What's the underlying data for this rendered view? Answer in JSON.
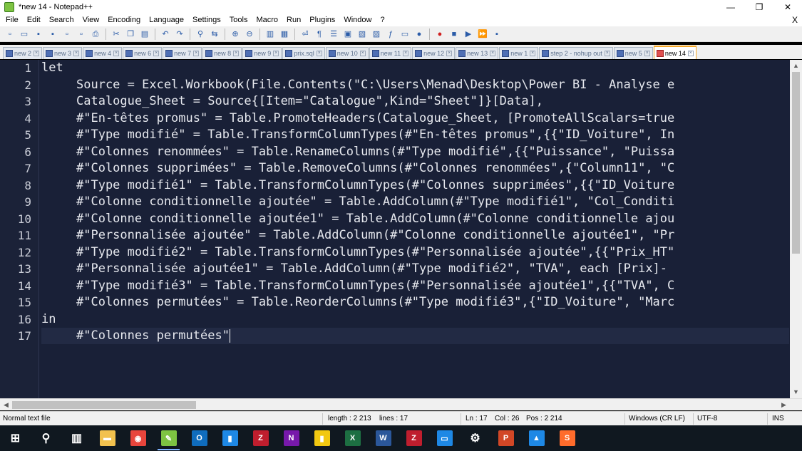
{
  "window": {
    "title": "*new 14 - Notepad++",
    "controls": {
      "minimize": "—",
      "maximize": "❐",
      "close": "✕"
    }
  },
  "menu": {
    "items": [
      "File",
      "Edit",
      "Search",
      "View",
      "Encoding",
      "Language",
      "Settings",
      "Tools",
      "Macro",
      "Run",
      "Plugins",
      "Window",
      "?"
    ],
    "close_doc": "X"
  },
  "tabs": [
    {
      "label": "new 2"
    },
    {
      "label": "new 3"
    },
    {
      "label": "new 4"
    },
    {
      "label": "new 6"
    },
    {
      "label": "new 7"
    },
    {
      "label": "new 8"
    },
    {
      "label": "new 9"
    },
    {
      "label": "prix.sql"
    },
    {
      "label": "new 10"
    },
    {
      "label": "new 11"
    },
    {
      "label": "new 12"
    },
    {
      "label": "new 13"
    },
    {
      "label": "new 1"
    },
    {
      "label": "step 2 - nohup out"
    },
    {
      "label": "new 5"
    },
    {
      "label": "new 14",
      "active": true
    }
  ],
  "editor": {
    "lines": [
      {
        "num": "1",
        "text": "let"
      },
      {
        "num": "2",
        "text": "Source = Excel.Workbook(File.Contents(\"C:\\Users\\Menad\\Desktop\\Power BI - Analyse e"
      },
      {
        "num": "3",
        "text": "Catalogue_Sheet = Source{[Item=\"Catalogue\",Kind=\"Sheet\"]}[Data],"
      },
      {
        "num": "4",
        "text": "#\"En-têtes promus\" = Table.PromoteHeaders(Catalogue_Sheet, [PromoteAllScalars=true"
      },
      {
        "num": "5",
        "text": "#\"Type modifié\" = Table.TransformColumnTypes(#\"En-têtes promus\",{{\"ID_Voiture\", In"
      },
      {
        "num": "6",
        "text": "#\"Colonnes renommées\" = Table.RenameColumns(#\"Type modifié\",{{\"Puissance\", \"Puissa"
      },
      {
        "num": "7",
        "text": "#\"Colonnes supprimées\" = Table.RemoveColumns(#\"Colonnes renommées\",{\"Column11\", \"C"
      },
      {
        "num": "8",
        "text": "#\"Type modifié1\" = Table.TransformColumnTypes(#\"Colonnes supprimées\",{{\"ID_Voiture"
      },
      {
        "num": "9",
        "text": "#\"Colonne conditionnelle ajoutée\" = Table.AddColumn(#\"Type modifié1\", \"Col_Conditi"
      },
      {
        "num": "10",
        "text": "#\"Colonne conditionnelle ajoutée1\" = Table.AddColumn(#\"Colonne conditionnelle ajou"
      },
      {
        "num": "11",
        "text": "#\"Personnalisée ajoutée\" = Table.AddColumn(#\"Colonne conditionnelle ajoutée1\", \"Pr"
      },
      {
        "num": "12",
        "text": "#\"Type modifié2\" = Table.TransformColumnTypes(#\"Personnalisée ajoutée\",{{\"Prix_HT\""
      },
      {
        "num": "13",
        "text": "#\"Personnalisée ajoutée1\" = Table.AddColumn(#\"Type modifié2\", \"TVA\", each [Prix]-"
      },
      {
        "num": "14",
        "text": "#\"Type modifié3\" = Table.TransformColumnTypes(#\"Personnalisée ajoutée1\",{{\"TVA\", C"
      },
      {
        "num": "15",
        "text": "#\"Colonnes permutées\" = Table.ReorderColumns(#\"Type modifié3\",{\"ID_Voiture\", \"Marc"
      },
      {
        "num": "16",
        "text": "in"
      },
      {
        "num": "17",
        "text": "#\"Colonnes permutées\""
      }
    ]
  },
  "status": {
    "file_type": "Normal text file",
    "length": "length : 2 213",
    "lines": "lines : 17",
    "ln": "Ln : 17",
    "col": "Col : 26",
    "pos": "Pos : 2 214",
    "eol": "Windows (CR LF)",
    "encoding": "UTF-8",
    "mode": "INS"
  },
  "taskbar": {
    "items": [
      {
        "icon": "windows-start-icon",
        "color": "#ffffff"
      },
      {
        "icon": "search-icon",
        "color": "#ffffff"
      },
      {
        "icon": "task-view-icon",
        "color": "#ffffff"
      },
      {
        "icon": "file-explorer-icon",
        "color": "#f2c14e"
      },
      {
        "icon": "chrome-icon",
        "color": "#e8453c"
      },
      {
        "icon": "notepadpp-icon",
        "color": "#7ec342"
      },
      {
        "icon": "outlook-icon",
        "color": "#0f6cbd"
      },
      {
        "icon": "blue-app-icon",
        "color": "#1e88e5"
      },
      {
        "icon": "filezilla-icon",
        "color": "#bf1e2e"
      },
      {
        "icon": "onenote-icon",
        "color": "#7719aa"
      },
      {
        "icon": "power-bi-icon",
        "color": "#f2c811"
      },
      {
        "icon": "excel-icon",
        "color": "#1d6f42"
      },
      {
        "icon": "word-icon",
        "color": "#2b579a"
      },
      {
        "icon": "filezilla-icon-2",
        "color": "#bf1e2e"
      },
      {
        "icon": "screen-app-icon",
        "color": "#1e88e5"
      },
      {
        "icon": "settings-icon",
        "color": "#ffffff"
      },
      {
        "icon": "powerpoint-icon",
        "color": "#d24726"
      },
      {
        "icon": "photos-icon",
        "color": "#1e88e5"
      },
      {
        "icon": "sublime-icon",
        "color": "#ff6c2c"
      }
    ]
  }
}
